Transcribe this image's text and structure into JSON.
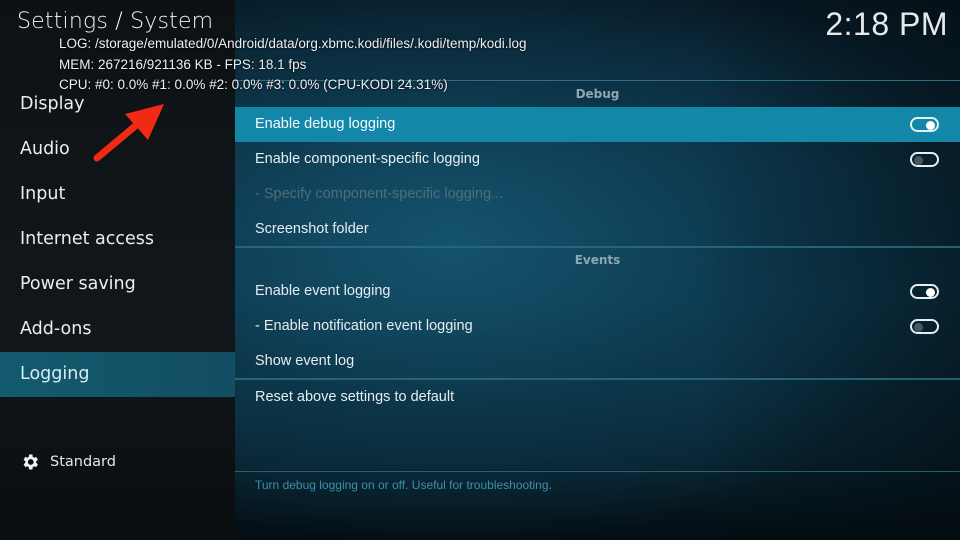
{
  "header": {
    "title": "Settings / System",
    "clock": "2:18 PM"
  },
  "debug_overlay": {
    "log": "LOG: /storage/emulated/0/Android/data/org.xbmc.kodi/files/.kodi/temp/kodi.log",
    "mem": "MEM: 267216/921136 KB - FPS: 18.1 fps",
    "cpu": "CPU: #0: 0.0% #1: 0.0% #2: 0.0% #3: 0.0% (CPU-KODI 24.31%)"
  },
  "sidebar": {
    "items": [
      {
        "label": "Display"
      },
      {
        "label": "Audio"
      },
      {
        "label": "Input"
      },
      {
        "label": "Internet access"
      },
      {
        "label": "Power saving"
      },
      {
        "label": "Add-ons"
      },
      {
        "label": "Logging",
        "active": true
      }
    ],
    "level_label": "Standard",
    "level_icon": "gear-icon"
  },
  "sections": {
    "debug": {
      "heading": "Debug",
      "items": [
        {
          "label": "Enable debug logging",
          "toggle": "on",
          "focused": true
        },
        {
          "label": "Enable component-specific logging",
          "toggle": "off"
        },
        {
          "label": "- Specify component-specific logging...",
          "disabled": true
        },
        {
          "label": "Screenshot folder"
        }
      ]
    },
    "events": {
      "heading": "Events",
      "items": [
        {
          "label": "Enable event logging",
          "toggle": "on"
        },
        {
          "label": "- Enable notification event logging",
          "toggle": "off"
        },
        {
          "label": "Show event log"
        }
      ]
    },
    "reset_label": "Reset above settings to default"
  },
  "help_text": "Turn debug logging on or off. Useful for troubleshooting.",
  "annotation": {
    "type": "arrow",
    "color": "#f02a14",
    "points_to": "debug_overlay"
  },
  "colors": {
    "focus": "#1387a8",
    "sidebar_active": "#135a6e",
    "help_text": "#3e8fa9"
  }
}
